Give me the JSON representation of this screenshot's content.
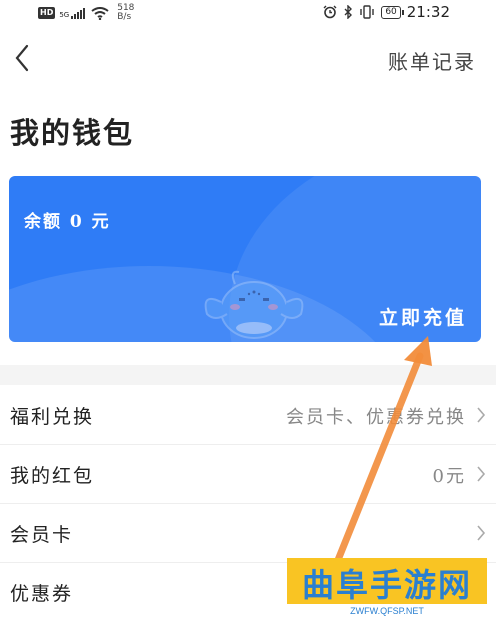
{
  "status_bar": {
    "badge": "HD",
    "network": "5G",
    "speed_value": "518",
    "speed_unit": "B/s",
    "battery": "60",
    "time": "21:32"
  },
  "nav": {
    "back_icon": "chevron-left-icon",
    "bill_link": "账单记录"
  },
  "page_title": "我的钱包",
  "wallet_card": {
    "balance": "余额 0 元",
    "recharge": "立即充值",
    "background_color": "#2f7cf6"
  },
  "menu": [
    {
      "label": "福利兑换",
      "value": "会员卡、优惠券兑换",
      "chevron": true
    },
    {
      "label": "我的红包",
      "value": "0元",
      "chevron": true
    },
    {
      "label": "会员卡",
      "value": "",
      "chevron": true
    },
    {
      "label": "优惠券",
      "value": "",
      "chevron": false
    }
  ],
  "watermark": {
    "text": "曲阜手游网",
    "url": "ZWFW.QFSP.NET"
  },
  "colors": {
    "annotation_arrow": "#f28c3a",
    "watermark_bg": "#f9c423",
    "watermark_text": "#2a7fd0"
  }
}
